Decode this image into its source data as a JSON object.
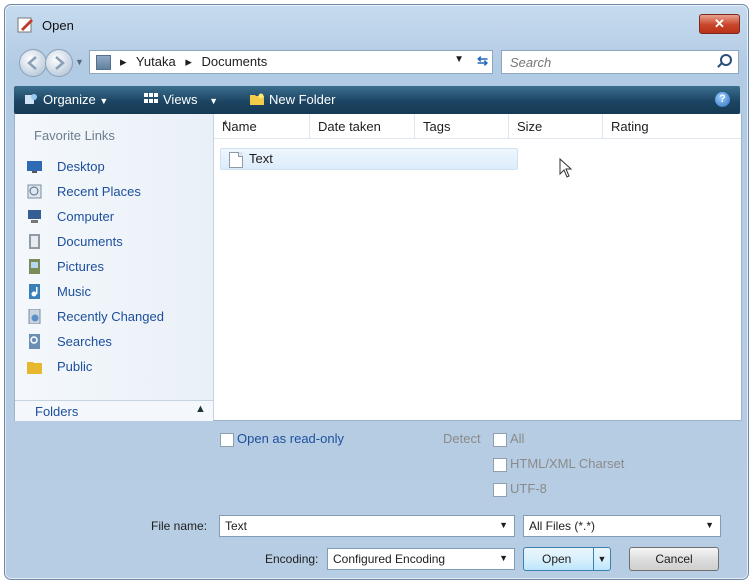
{
  "window": {
    "title": "Open",
    "close_label": "✕"
  },
  "address": {
    "crumbs": [
      "Yutaka",
      "Documents"
    ],
    "separator": "▸"
  },
  "search": {
    "placeholder": "Search"
  },
  "toolbar": {
    "organize": "Organize",
    "views": "Views",
    "new_folder": "New Folder",
    "help": "?"
  },
  "sidebar": {
    "title": "Favorite Links",
    "items": [
      {
        "label": "Desktop",
        "icon": "desktop-icon"
      },
      {
        "label": "Recent Places",
        "icon": "recent-places-icon"
      },
      {
        "label": "Computer",
        "icon": "computer-icon"
      },
      {
        "label": "Documents",
        "icon": "documents-icon"
      },
      {
        "label": "Pictures",
        "icon": "pictures-icon"
      },
      {
        "label": "Music",
        "icon": "music-icon"
      },
      {
        "label": "Recently Changed",
        "icon": "recently-changed-icon"
      },
      {
        "label": "Searches",
        "icon": "searches-icon"
      },
      {
        "label": "Public",
        "icon": "public-icon"
      }
    ],
    "folders_label": "Folders"
  },
  "columns": [
    "Name",
    "Date taken",
    "Tags",
    "Size",
    "Rating"
  ],
  "files": [
    {
      "name": "Text"
    }
  ],
  "options": {
    "read_only": "Open as read-only",
    "detect": "Detect",
    "detect_all": "All",
    "detect_html": "HTML/XML Charset",
    "detect_utf8": "UTF-8"
  },
  "form": {
    "file_name_label": "File name:",
    "file_name_value": "Text",
    "file_type_value": "All Files (*.*)",
    "encoding_label": "Encoding:",
    "encoding_value": "Configured Encoding",
    "open_label": "Open",
    "cancel_label": "Cancel"
  },
  "colors": {
    "toolbar": "#1c4563",
    "link": "#1c4f9c",
    "close": "#c9452a"
  }
}
